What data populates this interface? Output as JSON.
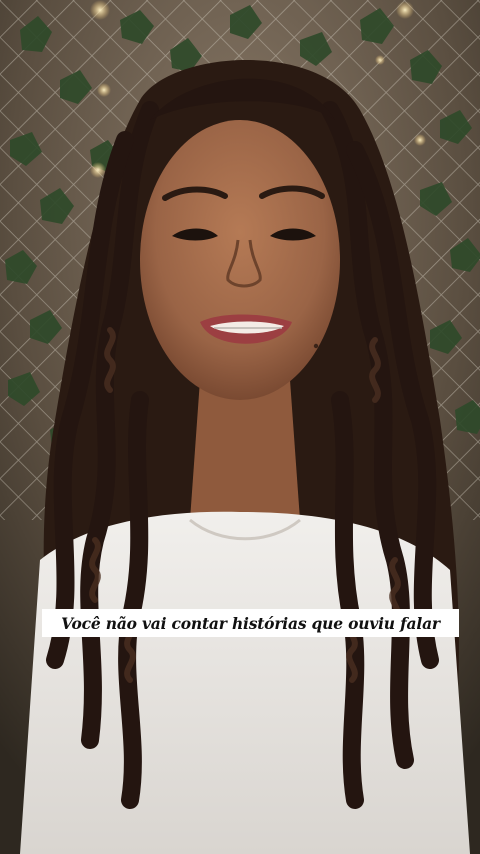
{
  "video": {
    "caption": "Você não vai contar histórias que ouviu falar"
  }
}
